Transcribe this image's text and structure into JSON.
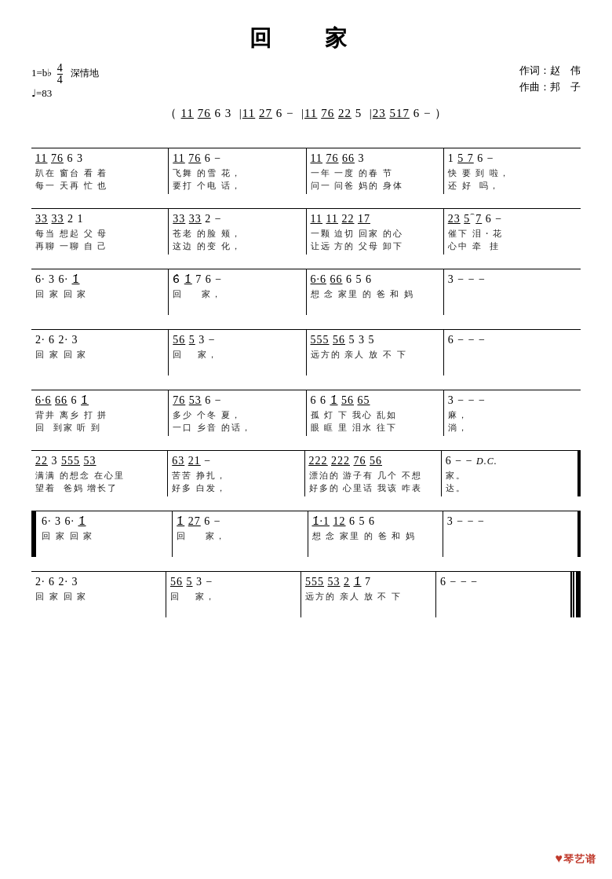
{
  "title": "回　家",
  "meta": {
    "time_signature": "4/4",
    "key": "1=b♭",
    "tempo": "♩=83",
    "hint": "深情地",
    "lyricist": "作词：赵　伟",
    "composer": "作曲：邦　子"
  },
  "intro": {
    "notes": "（ <u>11</u> <u>76</u> 6 3　|<u>11</u> <u>27</u> 6 −　|<u>11</u> <u>76</u> <u>22</u> 5　|<u>23</u> <u>517</u> 6 −）"
  },
  "sections": [],
  "logo": "♥琴艺谱"
}
